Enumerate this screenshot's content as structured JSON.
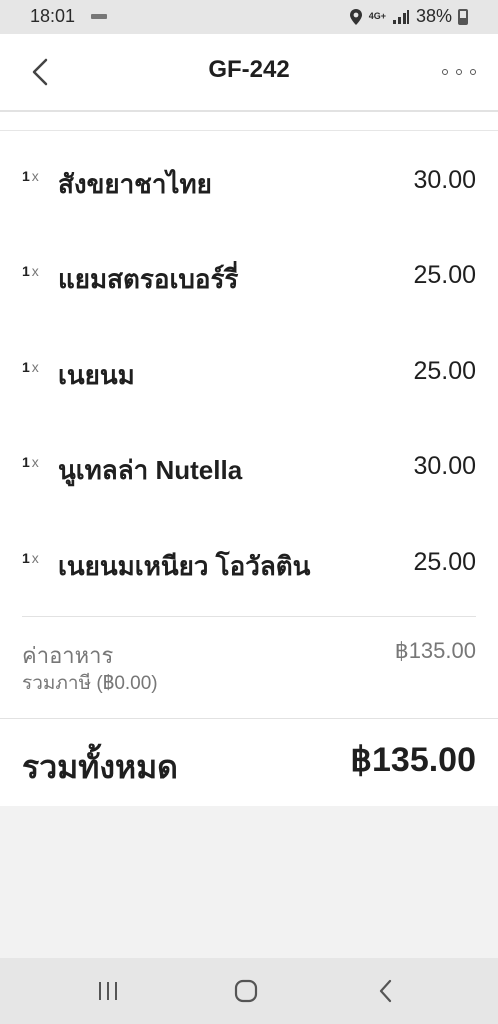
{
  "status_bar": {
    "time": "18:01",
    "network": "4G+",
    "battery": "38%",
    "icons": [
      "location-icon",
      "signal-icon",
      "battery-icon"
    ]
  },
  "header": {
    "title": "GF-242",
    "back_icon": "chevron-left-icon",
    "more_icon": "more-dots-icon"
  },
  "items": [
    {
      "qty": "1",
      "x": "x",
      "name": "สังขยาชาไทย",
      "price": "30.00"
    },
    {
      "qty": "1",
      "x": "x",
      "name": "แยมสตรอเบอร์รี่",
      "price": "25.00"
    },
    {
      "qty": "1",
      "x": "x",
      "name": "เนยนม",
      "price": "25.00"
    },
    {
      "qty": "1",
      "x": "x",
      "name": "นูเทลล่า Nutella",
      "price": "30.00"
    },
    {
      "qty": "1",
      "x": "x",
      "name": "เนยนมเหนียว โอวัลติน",
      "price": "25.00"
    }
  ],
  "summary": {
    "subtotal_label": "ค่าอาหาร",
    "subtotal_value": "฿135.00",
    "tax_label": "รวมภาษี (฿0.00)",
    "total_label": "รวมทั้งหมด",
    "total_value": "฿135.00"
  },
  "nav_bar": {
    "icons": [
      "recent-apps-icon",
      "home-icon",
      "back-icon"
    ]
  }
}
